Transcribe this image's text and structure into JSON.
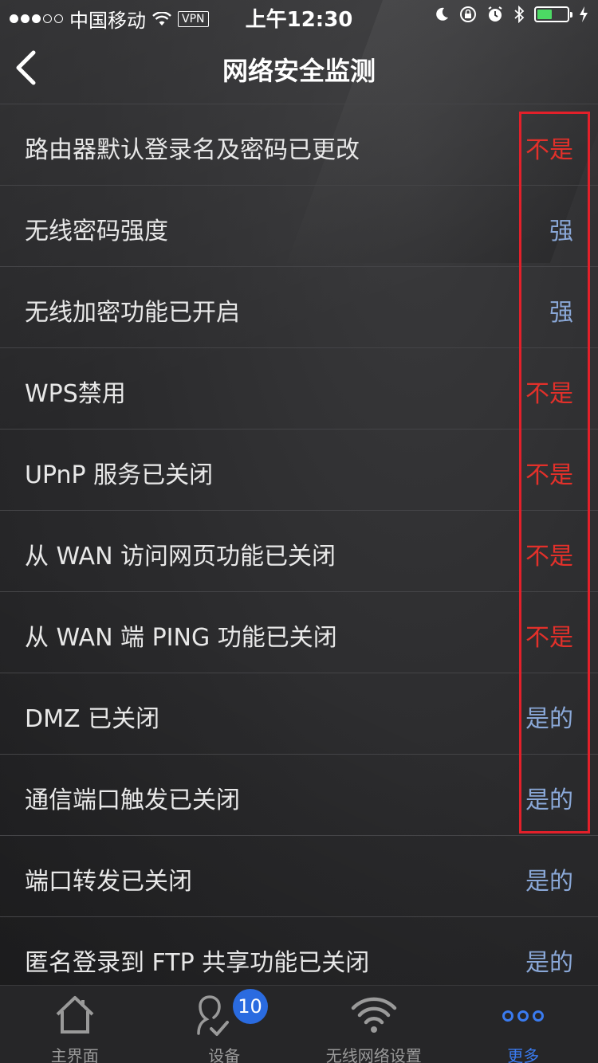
{
  "status_bar": {
    "carrier": "中国移动",
    "vpn": "VPN",
    "time": "上午12:30",
    "battery_level": 0.5
  },
  "nav": {
    "title": "网络安全监测"
  },
  "colors": {
    "value_red": "#e3302a",
    "value_blue": "#8aa8d8",
    "highlight": "#e3202a",
    "tab_active": "#3a7bf0"
  },
  "items": [
    {
      "label": "路由器默认登录名及密码已更改",
      "value": "不是",
      "status": "red"
    },
    {
      "label": "无线密码强度",
      "value": "强",
      "status": "blue"
    },
    {
      "label": "无线加密功能已开启",
      "value": "强",
      "status": "blue"
    },
    {
      "label": "WPS禁用",
      "value": "不是",
      "status": "red"
    },
    {
      "label": "UPnP 服务已关闭",
      "value": "不是",
      "status": "red"
    },
    {
      "label": "从 WAN 访问网页功能已关闭",
      "value": "不是",
      "status": "red"
    },
    {
      "label": "从 WAN 端 PING 功能已关闭",
      "value": "不是",
      "status": "red"
    },
    {
      "label": "DMZ 已关闭",
      "value": "是的",
      "status": "blue"
    },
    {
      "label": "通信端口触发已关闭",
      "value": "是的",
      "status": "blue"
    },
    {
      "label": "端口转发已关闭",
      "value": "是的",
      "status": "blue"
    },
    {
      "label": "匿名登录到 FTP 共享功能已关闭",
      "value": "是的",
      "status": "blue"
    }
  ],
  "tabs": [
    {
      "label": "主界面",
      "icon": "home-icon"
    },
    {
      "label": "设备",
      "icon": "devices-icon",
      "badge": "10"
    },
    {
      "label": "无线网络设置",
      "icon": "wifi-icon"
    },
    {
      "label": "更多",
      "icon": "more-icon",
      "active": true
    }
  ]
}
